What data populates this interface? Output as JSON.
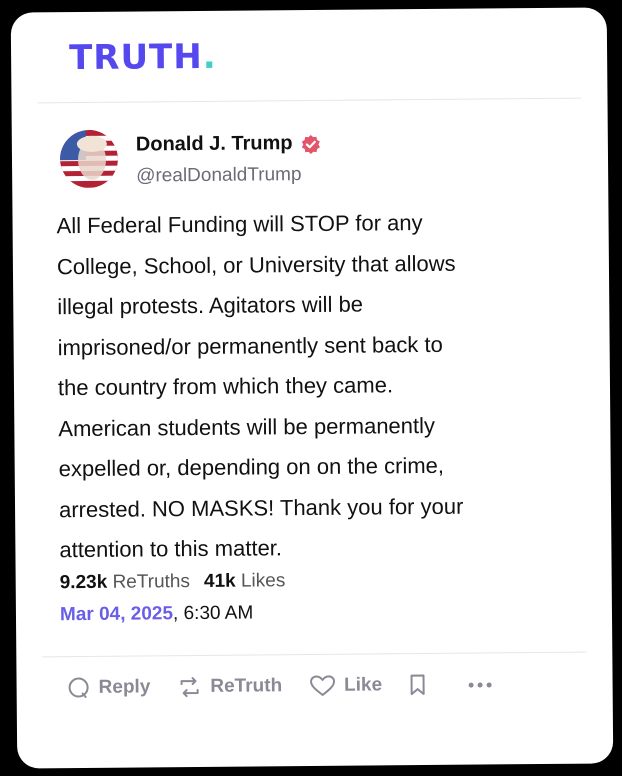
{
  "brand": {
    "logo_text": "TRUTH",
    "logo_dot": ".",
    "accent": "#5448ee",
    "dot_color": "#3ed0c6"
  },
  "post": {
    "author_name": "Donald J. Trump",
    "author_handle": "@realDonaldTrump",
    "verified_icon": "verified-badge-icon",
    "text": "All Federal Funding will STOP for any\nCollege, School, or University that allows\nillegal protests. Agitators will be\nimprisoned/or permanently sent back to\nthe country from which they came.\nAmerican students will be permanently\nexpelled or, depending on on the crime,\narrested. NO MASKS! Thank you for your\nattention to this matter.",
    "retruths_count": "9.23k",
    "retruths_label": "ReTruths",
    "likes_count": "41k",
    "likes_label": "Likes",
    "date": "Mar 04, 2025",
    "time": ", 6:30 AM"
  },
  "actions": {
    "reply_label": "Reply",
    "retruth_label": "ReTruth",
    "like_label": "Like"
  }
}
